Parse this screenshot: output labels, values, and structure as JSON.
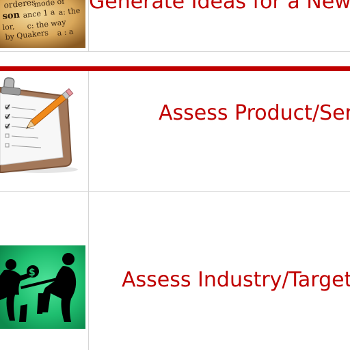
{
  "colors": {
    "link": "#c00000",
    "divider_accent": "#c00000",
    "grid": "#d6d6d6"
  },
  "rows": [
    {
      "label": "Generate Ideas for a New",
      "icon": "book-dictionary-icon"
    },
    {
      "label": "Assess Product/Ser",
      "icon": "clipboard-checklist-icon"
    },
    {
      "label": "Assess Industry/Target",
      "icon": "tug-of-war-silhouette-icon"
    }
  ]
}
